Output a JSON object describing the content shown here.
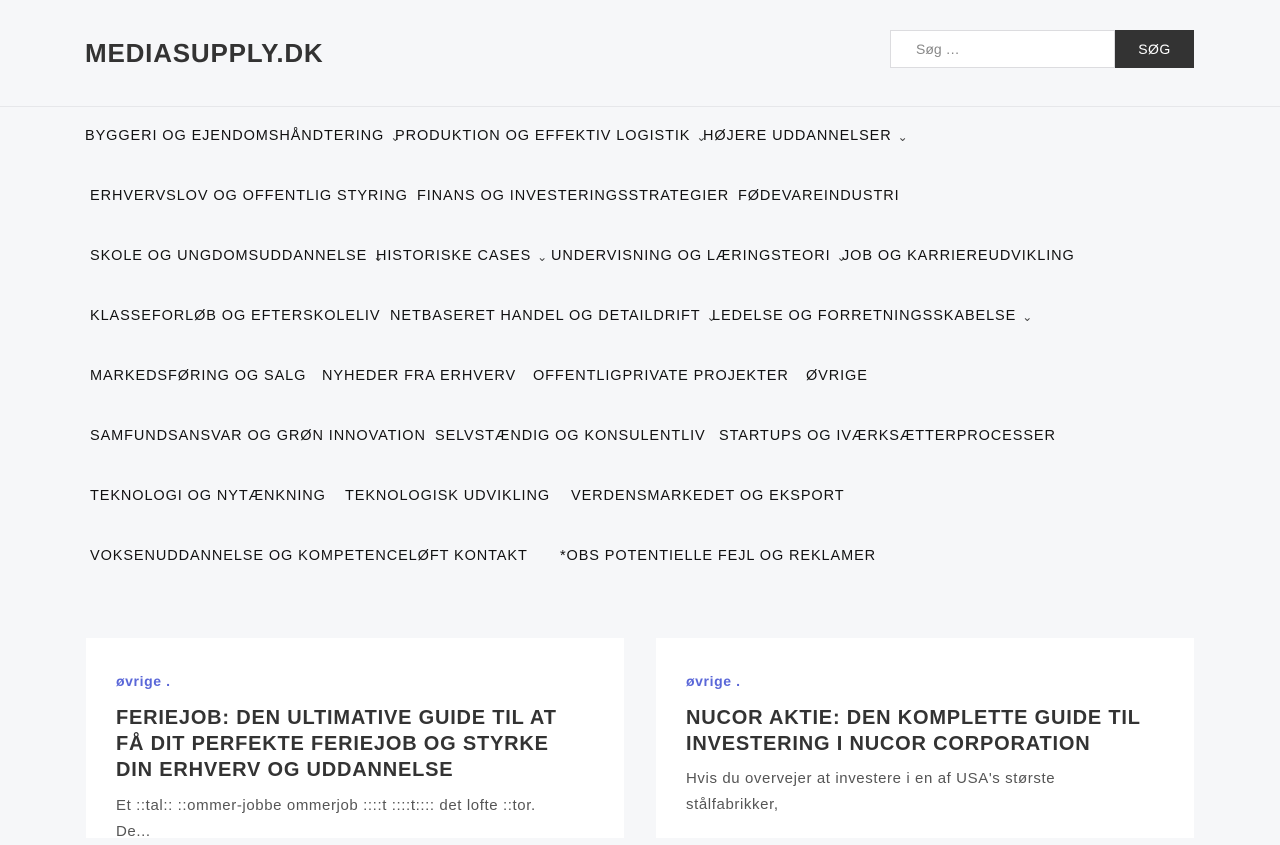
{
  "header": {
    "site_title": "MEDIASUPPLY.DK",
    "search_placeholder": "Søg …",
    "search_button": "SØG"
  },
  "nav": [
    {
      "label": "BYGGERI OG EJENDOMSHÅNDTERING",
      "has_submenu": true
    },
    {
      "label": "PRODUKTION OG EFFEKTIV LOGISTIK",
      "has_submenu": true
    },
    {
      "label": "HØJERE UDDANNELSER",
      "has_submenu": true
    },
    {
      "label": "ERHVERVSLOV OG OFFENTLIG STYRING",
      "has_submenu": false
    },
    {
      "label": "FINANS OG INVESTERINGSSTRATEGIER",
      "has_submenu": false
    },
    {
      "label": "FØDEVAREINDUSTRI",
      "has_submenu": false
    },
    {
      "label": "SKOLE OG UNGDOMSUDDANNELSE",
      "has_submenu": true
    },
    {
      "label": "HISTORISKE CASES",
      "has_submenu": true
    },
    {
      "label": "UNDERVISNING OG LÆRINGSTEORI",
      "has_submenu": true
    },
    {
      "label": "JOB OG KARRIEREUDVIKLING",
      "has_submenu": false
    },
    {
      "label": "KLASSEFORLØB OG EFTERSKOLELIV",
      "has_submenu": false
    },
    {
      "label": "NETBASERET HANDEL OG DETAILDRIFT",
      "has_submenu": true
    },
    {
      "label": "LEDELSE OG FORRETNINGSSKABELSE",
      "has_submenu": true
    },
    {
      "label": "MARKEDSFØRING OG SALG",
      "has_submenu": false
    },
    {
      "label": "NYHEDER FRA ERHVERV",
      "has_submenu": false
    },
    {
      "label": "OFFENTLIGPRIVATE PROJEKTER",
      "has_submenu": false
    },
    {
      "label": "ØVRIGE",
      "has_submenu": false
    },
    {
      "label": "SAMFUNDSANSVAR OG GRØN INNOVATION",
      "has_submenu": false
    },
    {
      "label": "SELVSTÆNDIG OG KONSULENTLIV",
      "has_submenu": false
    },
    {
      "label": "STARTUPS OG IVÆRKSÆTTERPROCESSER",
      "has_submenu": false
    },
    {
      "label": "TEKNOLOGI OG NYTÆNKNING",
      "has_submenu": false
    },
    {
      "label": "TEKNOLOGISK UDVIKLING",
      "has_submenu": false
    },
    {
      "label": "VERDENSMARKEDET OG EKSPORT",
      "has_submenu": false
    },
    {
      "label": "VOKSENUDDANNELSE OG KOMPETENCELØFT",
      "has_submenu": false
    },
    {
      "label": "KONTAKT",
      "has_submenu": false
    },
    {
      "label": "*OBS POTENTIELLE FEJL OG REKLAMER",
      "has_submenu": false
    }
  ],
  "posts": [
    {
      "category": "øvrige .",
      "title": "FERIEJOB: DEN ULTIMATIVE GUIDE TIL AT FÅ DIT PERFEKTE FERIEJOB OG STYRKE DIN ERHVERV OG UDDANNELSE",
      "excerpt": "Et ::tal:: ::ommer-jobbe ommerjob ::::t ::::t:::: det lofte ::tor. De..."
    },
    {
      "category": "øvrige .",
      "title": "NUCOR AKTIE: DEN KOMPLETTE GUIDE TIL INVESTERING I NUCOR CORPORATION",
      "excerpt": "Hvis du overvejer at investere i en af USA's største stålfabrikker,"
    }
  ],
  "colors": {
    "background": "#f6f7f9",
    "accent": "#5a67d8",
    "dark": "#333333"
  },
  "icons": {
    "submenu": "chevron-down-icon"
  }
}
